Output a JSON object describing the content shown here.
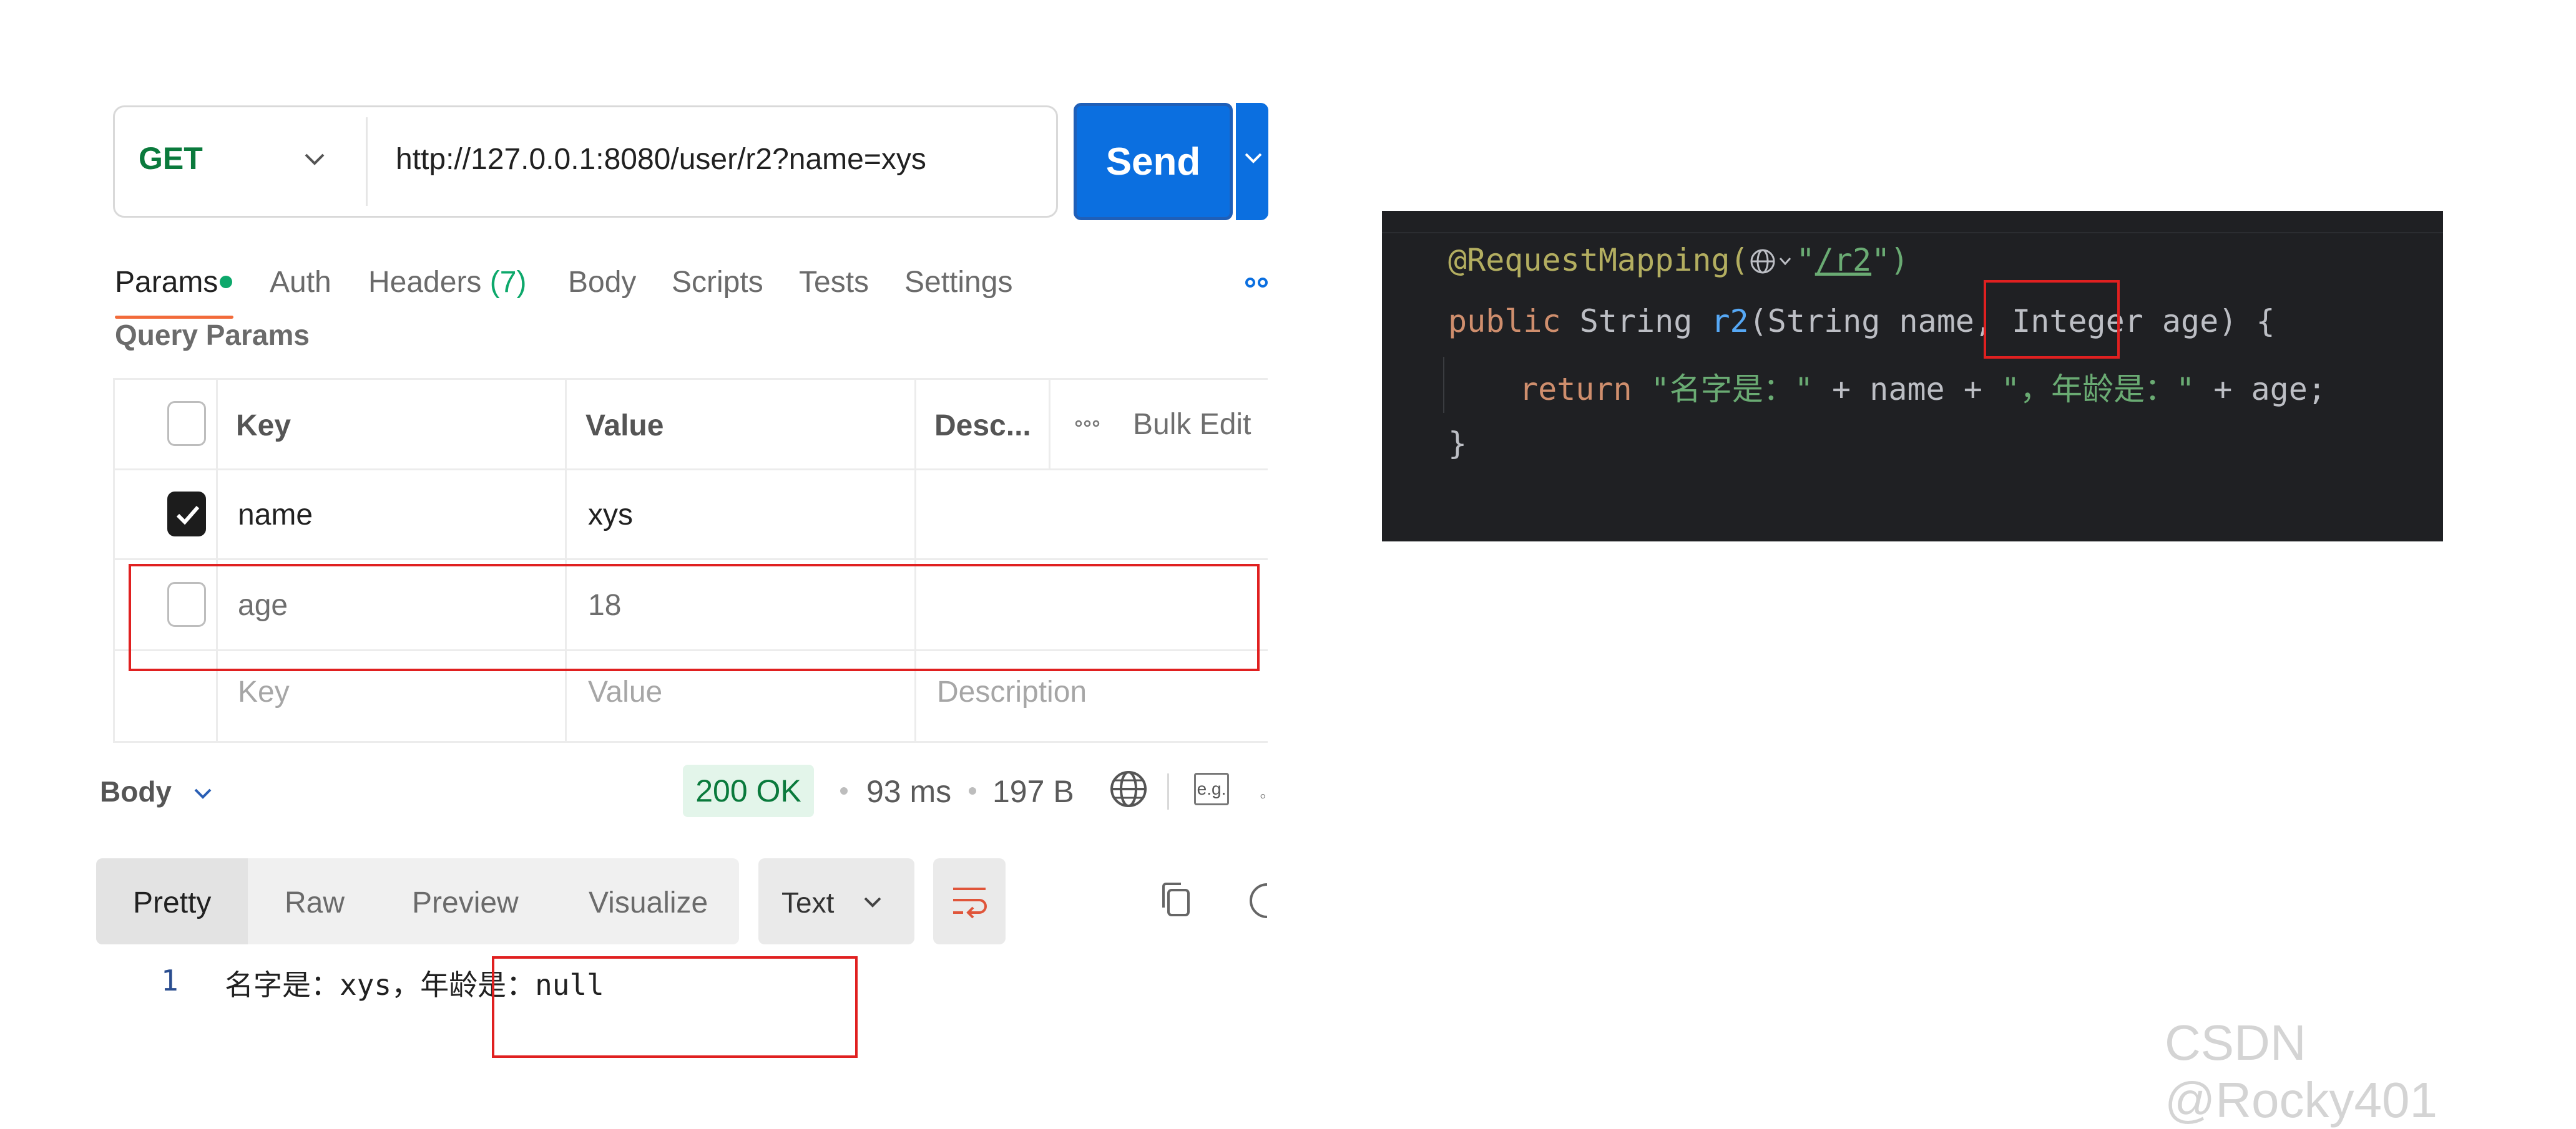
{
  "request": {
    "method": "GET",
    "url": "http://127.0.0.1:8080/user/r2?name=xys",
    "send_label": "Send"
  },
  "tabs": {
    "params": "Params",
    "auth": "Auth",
    "headers": "Headers",
    "headers_count": "(7)",
    "body": "Body",
    "scripts": "Scripts",
    "tests": "Tests",
    "settings": "Settings"
  },
  "query_params": {
    "title": "Query Params",
    "columns": {
      "key": "Key",
      "value": "Value",
      "description": "Desc...",
      "bulk_edit": "Bulk Edit"
    },
    "rows": [
      {
        "key": "name",
        "value": "xys",
        "checked": true
      },
      {
        "key": "age",
        "value": "18",
        "checked": false
      }
    ],
    "placeholders": {
      "key": "Key",
      "value": "Value",
      "description": "Description"
    }
  },
  "response": {
    "body_label": "Body",
    "status": "200 OK",
    "time": "93 ms",
    "size": "197 B",
    "eg_label": "e.g.",
    "view_tabs": [
      "Pretty",
      "Raw",
      "Preview",
      "Visualize"
    ],
    "format": "Text",
    "line_number": "1",
    "content": "名字是：xys，年龄是：null"
  },
  "code": {
    "line1_annotation": "@RequestMapping(",
    "line1_path": "/r2",
    "line1_quote_open": "\"",
    "line1_close": "\")",
    "line2_kw": "public",
    "line2_a": " String ",
    "line2_fn": "r2",
    "line2_b": "(String name, ",
    "line2_type": "Integer",
    "line2_c": " age) {",
    "line3_kw": "return ",
    "line3_s1": "\"名字是：\"",
    "line3_a": " + name + ",
    "line3_s2": "\"，年龄是：\"",
    "line3_b": " + age;",
    "line4": "}"
  },
  "icons": {
    "method_dropdown": "chevron-down-icon",
    "send_dropdown": "chevron-down-icon",
    "more": "more-horizontal-icon",
    "bulk_more": "more-horizontal-icon",
    "globe": "globe-icon",
    "wrap": "word-wrap-icon",
    "copy": "copy-icon",
    "search": "search-icon"
  },
  "colors": {
    "send_button": "#0b6fe0",
    "method_get": "#0a7a3c",
    "status_ok_bg": "#e3f5ea",
    "active_tab_underline": "#f26b3a",
    "highlight_box": "#e02020",
    "editor_bg": "#1f2023"
  },
  "watermark": "CSDN @Rocky401"
}
